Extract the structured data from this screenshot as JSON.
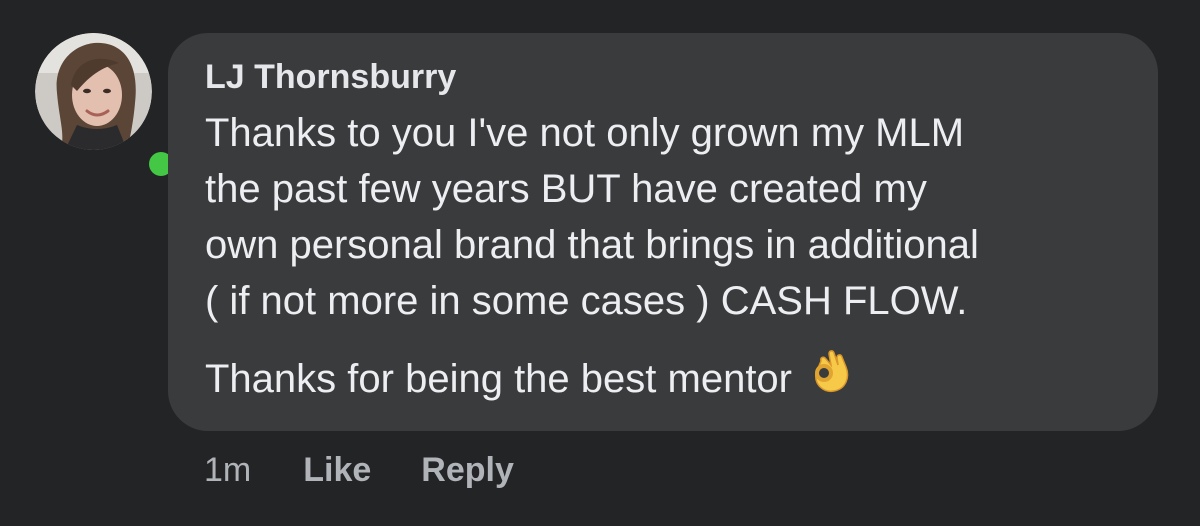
{
  "comment": {
    "author": "LJ Thornsburry",
    "lines": [
      "Thanks to you I've not only grown my MLM",
      "the past few years BUT have created my",
      "own personal brand that brings in additional",
      "( if not more in some cases ) CASH FLOW."
    ],
    "closing": "Thanks for being the best mentor",
    "emoji_icon": "ok-hand-icon",
    "online_status_color": "#43c744"
  },
  "actions": {
    "time": "1m",
    "like_label": "Like",
    "reply_label": "Reply"
  }
}
